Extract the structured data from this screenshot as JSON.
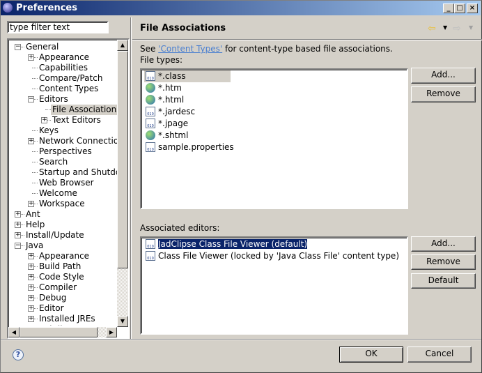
{
  "window": {
    "title": "Preferences",
    "controls": [
      "_",
      "□",
      "×"
    ]
  },
  "filter": {
    "placeholder": "type filter text",
    "value": "type filter text"
  },
  "tree": [
    {
      "label": "General",
      "level": 0,
      "exp": "-"
    },
    {
      "label": "Appearance",
      "level": 1,
      "exp": "+"
    },
    {
      "label": "Capabilities",
      "level": 1
    },
    {
      "label": "Compare/Patch",
      "level": 1
    },
    {
      "label": "Content Types",
      "level": 1
    },
    {
      "label": "Editors",
      "level": 1,
      "exp": "-"
    },
    {
      "label": "File Associations",
      "level": 2,
      "selected": true
    },
    {
      "label": "Text Editors",
      "level": 2,
      "exp": "+"
    },
    {
      "label": "Keys",
      "level": 1
    },
    {
      "label": "Network Connection",
      "level": 1,
      "exp": "+"
    },
    {
      "label": "Perspectives",
      "level": 1
    },
    {
      "label": "Search",
      "level": 1
    },
    {
      "label": "Startup and Shutdow",
      "level": 1
    },
    {
      "label": "Web Browser",
      "level": 1
    },
    {
      "label": "Welcome",
      "level": 1
    },
    {
      "label": "Workspace",
      "level": 1,
      "exp": "+"
    },
    {
      "label": "Ant",
      "level": 0,
      "exp": "+"
    },
    {
      "label": "Help",
      "level": 0,
      "exp": "+"
    },
    {
      "label": "Install/Update",
      "level": 0,
      "exp": "+"
    },
    {
      "label": "Java",
      "level": 0,
      "exp": "-"
    },
    {
      "label": "Appearance",
      "level": 1,
      "exp": "+"
    },
    {
      "label": "Build Path",
      "level": 1,
      "exp": "+"
    },
    {
      "label": "Code Style",
      "level": 1,
      "exp": "+"
    },
    {
      "label": "Compiler",
      "level": 1,
      "exp": "+"
    },
    {
      "label": "Debug",
      "level": 1,
      "exp": "+"
    },
    {
      "label": "Editor",
      "level": 1,
      "exp": "+"
    },
    {
      "label": "Installed JREs",
      "level": 1,
      "exp": "+"
    },
    {
      "label": "JadClipse",
      "level": 1,
      "exp": "+"
    }
  ],
  "page": {
    "title": "File Associations",
    "see_prefix": "See ",
    "see_link": "'Content Types'",
    "see_suffix": " for content-type based file associations.",
    "file_types_label": "File types:",
    "file_types": [
      {
        "label": "*.class",
        "icon": "class-file-icon",
        "selected": true
      },
      {
        "label": "*.htm",
        "icon": "globe-icon"
      },
      {
        "label": "*.html",
        "icon": "globe-icon"
      },
      {
        "label": "*.jardesc",
        "icon": "jar-icon"
      },
      {
        "label": "*.jpage",
        "icon": "jpage-icon"
      },
      {
        "label": "*.shtml",
        "icon": "globe-icon"
      },
      {
        "label": "sample.properties",
        "icon": "properties-file-icon"
      }
    ],
    "editors_label": "Associated editors:",
    "editors": [
      {
        "label": "JadClipse Class File Viewer (default)",
        "selected": true
      },
      {
        "label": "Class File Viewer (locked by 'Java Class File' content type)"
      }
    ],
    "buttons": {
      "add": "Add...",
      "remove": "Remove",
      "add2": "Add...",
      "remove2": "Remove",
      "default": "Default"
    }
  },
  "footer": {
    "ok": "OK",
    "cancel": "Cancel",
    "help": "?"
  }
}
